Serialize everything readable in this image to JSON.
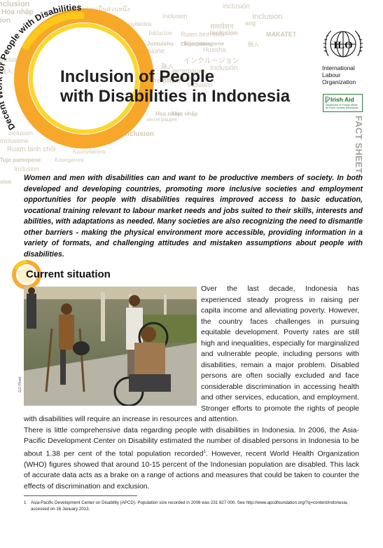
{
  "header": {
    "title_line1": "Inclusion of People",
    "title_line2": "with Disabilities in Indonesia",
    "series_title": "Decent Work for People with Disabilities",
    "word_cloud": [
      "Inclusion",
      "Hoa nhập",
      "Husisha",
      "การเข้าร่วมเป็นส่วนหนึ่ง",
      "Inclusion",
      "inclusión",
      "Kuunyitaniira",
      "ion",
      "समावेशन",
      "ang",
      "Inklusion",
      "Einbeziehung",
      "Inclusion",
      "Inclusion",
      "MAKATET",
      "Ruam binh chổi",
      "Jumuisho",
      "Tuje pamopene",
      "融入",
      "Inclusione",
      "Husisha",
      "Inclusión",
      "インクルージョン",
      "融入",
      "интеграция",
      "Inclusion",
      "融入",
      "интеграции",
      "Einbeziehung",
      "Inclusion",
      "Hoa nhập",
      "интеграция",
      "Inclusion",
      "Inclusione",
      "Ruam binh chổi",
      "Tuje pamopene",
      "Koongerere",
      "Inclusion",
      "Kuunyitaniira",
      "sion",
      "inclusion",
      "Hoa nhập"
    ]
  },
  "logos": {
    "ilo_mark": "ILO",
    "ilo_name_line1": "International",
    "ilo_name_line2": "Labour",
    "ilo_name_line3": "Organization",
    "irish_aid": "Irish Aid",
    "irish_aid_sub": "Department of Foreign Affairs An Roinn Gnóthaí Eachtracha"
  },
  "side_label": "FACT SHEET",
  "intro": "Women and men with disabilities can and want to be productive members of society. In both developed and developing countries, promoting more inclusive societies and employment opportunities  for people with disabilities requires improved access to basic education, vocational training relevant to labour market needs and jobs suited to their skills, interests and abilities, with adaptations as needed. Many societies are also recognizing the need to dismantle other barriers - making the physical environment more accessible, providing information in a variety of formats, and challenging attitudes and mistaken assumptions about people with disabilities.",
  "section": {
    "heading": "Current situation",
    "photo_credit": "ILO Photo",
    "paragraph1": "Over the last decade, Indonesia has experienced steady progress in raising per capita income and alleviating poverty. However, the country faces challenges in pursuing equitable development. Poverty rates are still high and inequalities, especially for marginalized and vulnerable people, including persons with disabilities, remain a major problem. Disabled persons are often socially excluded and face considerable discrimination in accessing health and other services, education, and employment. Stronger efforts to promote the rights of people with disabilities will require an increase in resources and attention.",
    "paragraph2_a": "There is little comprehensive data regarding people with disabilities in Indonesia. In 2006, the Asia-Pacific Development Center on Disability estimated the number of disabled persons in Indonesia to be about 1.38 per cent of the total population recorded",
    "paragraph2_sup": "1",
    "paragraph2_b": ".  However, recent World Health Organization (WHO) figures showed that around 10-15 percent of the Indonesian population are disabled. This lack of accurate data acts as a brake on a range of actions and measures that could be taken to counter the effects of discrimination and exclusion."
  },
  "footnote": {
    "number": "1",
    "text": "Asia-Pacific Development Center on Disability (APCD). Population size recorded in 2006 was 231 627 000.  See http://www.apcdfoundation.org/?q=content/indonesia, accessed on 16 January 2013."
  },
  "colors": {
    "accent_orange": "#f39a1e",
    "accent_yellow": "#fcd116",
    "cloud_text": "#cfc7b7",
    "irish_green": "#1f6e2b",
    "side_label_grey": "#a0a09b"
  }
}
